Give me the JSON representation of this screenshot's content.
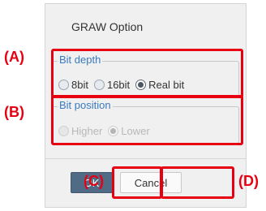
{
  "dialog": {
    "title": "GRAW Option",
    "bit_depth": {
      "legend": "Bit depth",
      "options": [
        {
          "label": "8bit",
          "checked": false
        },
        {
          "label": "16bit",
          "checked": false
        },
        {
          "label": "Real bit",
          "checked": true
        }
      ]
    },
    "bit_position": {
      "legend": "Bit position",
      "enabled": false,
      "options": [
        {
          "label": "Higher",
          "checked": false
        },
        {
          "label": "Lower",
          "checked": true
        }
      ]
    },
    "buttons": {
      "ok_label": "OK",
      "cancel_label": "Cancel"
    }
  },
  "annotations": {
    "a": "(A)",
    "b": "(B)",
    "c": "(C)",
    "d": "(D)",
    "color": "#e60012"
  }
}
